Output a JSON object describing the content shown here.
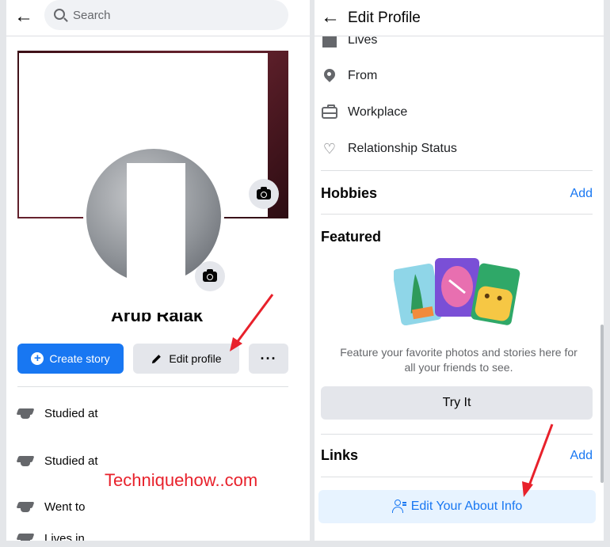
{
  "left_panel": {
    "search_placeholder": "Search",
    "name_fragment": "Arub Ralak",
    "buttons": {
      "create_story": "Create story",
      "edit_profile": "Edit profile",
      "more": "···"
    },
    "info_rows": [
      {
        "text": "Studied at",
        "icon": "graduation-cap-icon"
      },
      {
        "text": "Studied at",
        "icon": "graduation-cap-icon"
      },
      {
        "text": "Went to",
        "icon": "graduation-cap-icon"
      },
      {
        "text": "Lives in",
        "icon": "home-icon"
      }
    ]
  },
  "right_panel": {
    "title": "Edit Profile",
    "details": [
      {
        "text": "Lives",
        "icon": "home-icon"
      },
      {
        "text": "From",
        "icon": "location-pin-icon"
      },
      {
        "text": "Workplace",
        "icon": "briefcase-icon"
      },
      {
        "text": "Relationship Status",
        "icon": "hearts-icon"
      }
    ],
    "hobbies": {
      "title": "Hobbies",
      "action": "Add"
    },
    "featured": {
      "title": "Featured",
      "description": "Feature your favorite photos and stories here for all your friends to see.",
      "button": "Try It"
    },
    "links": {
      "title": "Links",
      "action": "Add"
    },
    "about_button": "Edit Your About Info"
  },
  "watermark": "Techniquehow..com",
  "colors": {
    "accent": "#1877f2",
    "arrow": "#e8212b"
  }
}
